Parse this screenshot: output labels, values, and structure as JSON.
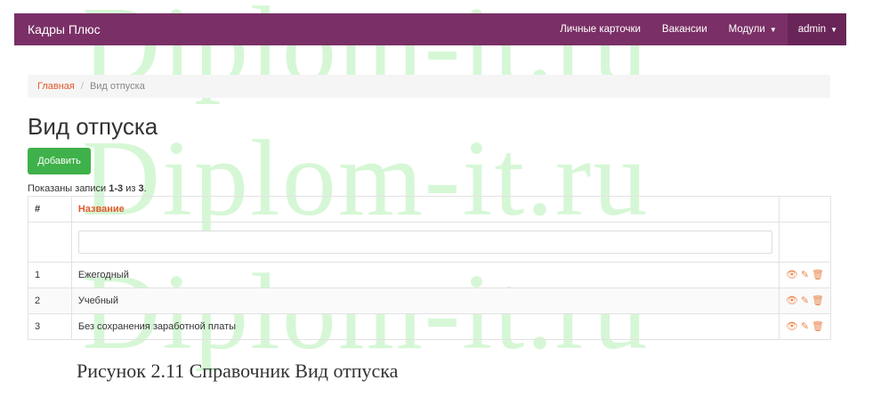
{
  "watermark": {
    "text": "Diplom-it.ru"
  },
  "navbar": {
    "brand": "Кадры Плюс",
    "links": [
      "Личные карточки",
      "Вакансии"
    ],
    "modules_label": "Модули",
    "user_label": "admin"
  },
  "breadcrumb": {
    "home": "Главная",
    "separator": "/",
    "current": "Вид отпуска"
  },
  "page": {
    "title": "Вид отпуска",
    "add_button": "Добавить",
    "summary_prefix": "Показаны записи",
    "summary_range": "1-3",
    "summary_mid": "из",
    "summary_total": "3",
    "summary_end": "."
  },
  "table": {
    "headers": {
      "num": "#",
      "name": "Название"
    },
    "rows": [
      {
        "num": "1",
        "name": "Ежегодный"
      },
      {
        "num": "2",
        "name": "Учебный"
      },
      {
        "num": "3",
        "name": "Без сохранения заработной платы"
      }
    ]
  },
  "caption": "Рисунок 2.11 Справочник Вид отпуска",
  "colors": {
    "navbar": "#7a2f66",
    "accent": "#e05a2b",
    "button": "#3fb14a",
    "icons": "#e8884f"
  }
}
